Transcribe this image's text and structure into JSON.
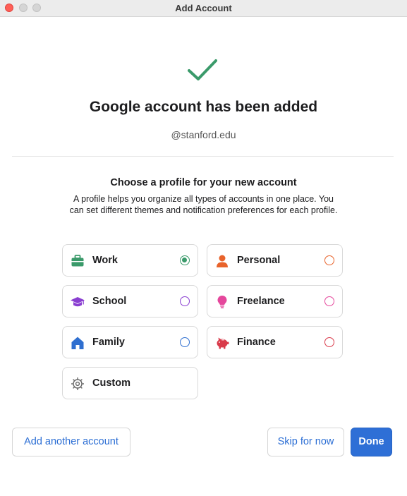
{
  "window": {
    "title": "Add Account"
  },
  "confirmation": {
    "headline": "Google account has been added",
    "email": "@stanford.edu"
  },
  "profile_section": {
    "heading": "Choose a profile for your new account",
    "description": "A profile helps you organize all types of accounts in one place. You can set different themes and notification preferences for each profile."
  },
  "profiles": [
    {
      "label": "Work",
      "icon": "briefcase-icon",
      "color": "#3a9a6a",
      "selected": true
    },
    {
      "label": "Personal",
      "icon": "person-icon",
      "color": "#e8632b",
      "selected": false
    },
    {
      "label": "School",
      "icon": "graduation-cap-icon",
      "color": "#8a3fd1",
      "selected": false
    },
    {
      "label": "Freelance",
      "icon": "lightbulb-icon",
      "color": "#e5479c",
      "selected": false
    },
    {
      "label": "Family",
      "icon": "house-icon",
      "color": "#2f6fd0",
      "selected": false
    },
    {
      "label": "Finance",
      "icon": "piggy-bank-icon",
      "color": "#d93a4a",
      "selected": false
    },
    {
      "label": "Custom",
      "icon": "gear-icon",
      "color": "#666666",
      "selected": false
    }
  ],
  "buttons": {
    "add_another": "Add another account",
    "skip": "Skip for now",
    "done": "Done"
  },
  "colors": {
    "accent": "#2e6fd6",
    "success": "#3a9a6a"
  }
}
